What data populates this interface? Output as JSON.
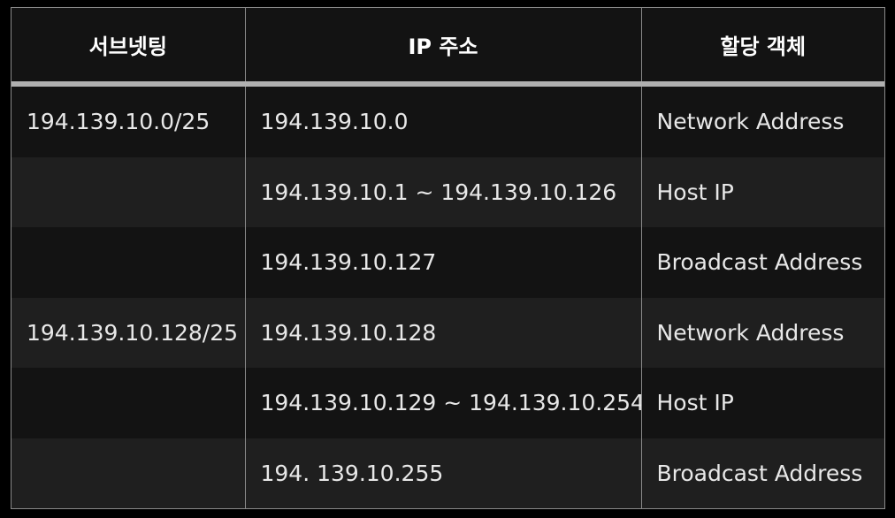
{
  "table": {
    "headers": [
      "서브넷팅",
      "IP 주소",
      "할당 객체"
    ],
    "rows": [
      [
        "194.139.10.0/25",
        "194.139.10.0",
        "Network Address"
      ],
      [
        "",
        "194.139.10.1 ~ 194.139.10.126",
        "Host IP"
      ],
      [
        "",
        "194.139.10.127",
        "Broadcast Address"
      ],
      [
        "194.139.10.128/25",
        "194.139.10.128",
        "Network Address"
      ],
      [
        "",
        "194.139.10.129 ~ 194.139.10.254",
        "Host IP"
      ],
      [
        "",
        "194. 139.10.255",
        "Broadcast Address"
      ]
    ]
  }
}
